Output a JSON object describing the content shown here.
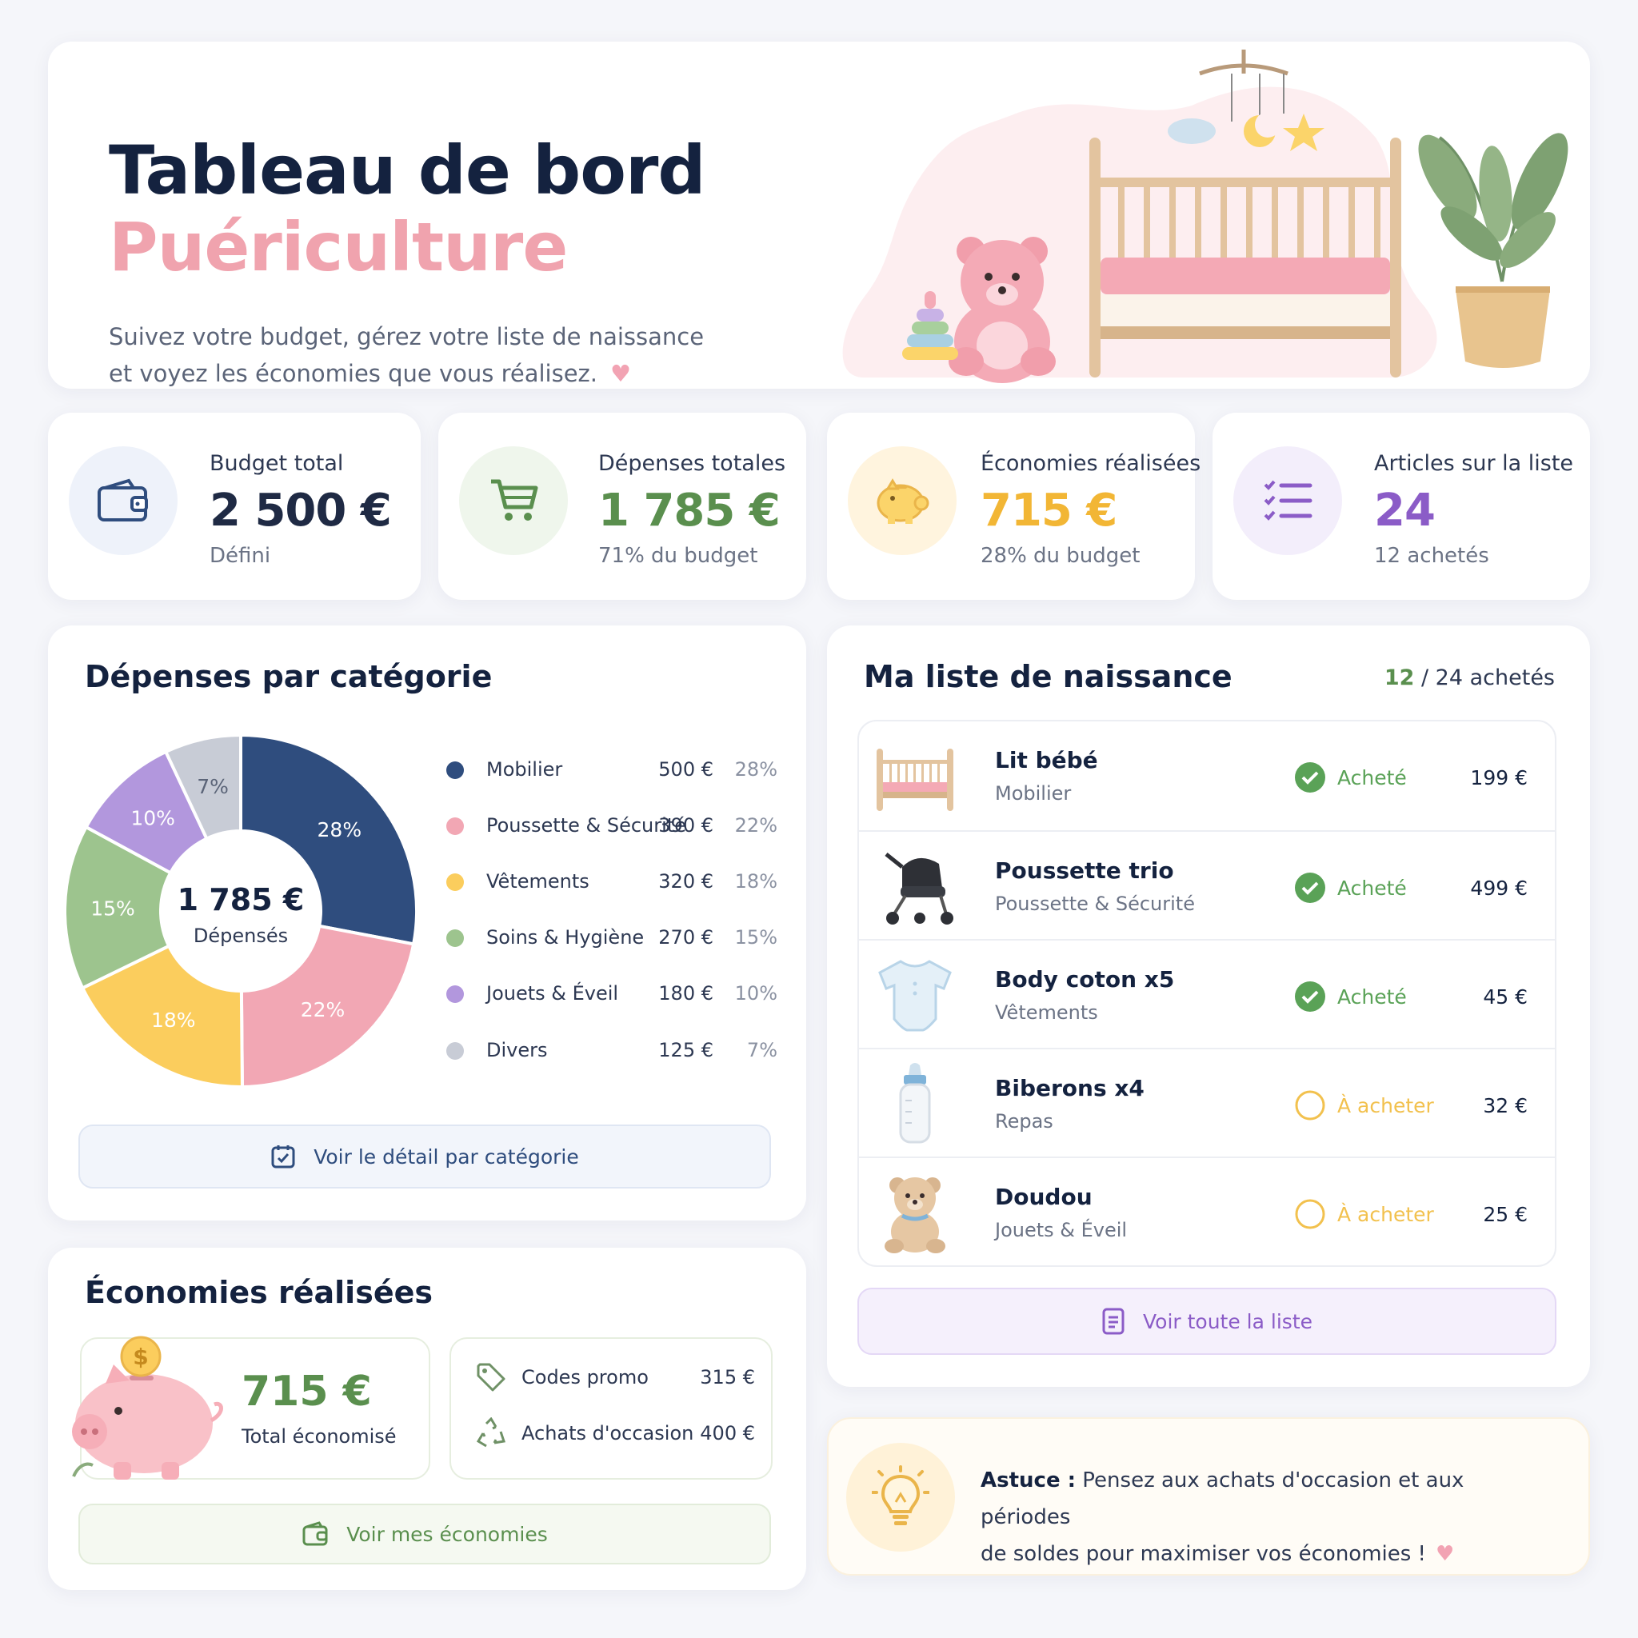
{
  "header": {
    "title_line1": "Tableau de bord",
    "title_line2": "Puériculture",
    "subtitle_line1": "Suivez votre budget, gérez votre liste de naissance",
    "subtitle_line2": "et voyez les économies que vous réalisez."
  },
  "stats": [
    {
      "label": "Budget total",
      "value": "2 500 €",
      "note": "Défini",
      "icon": "wallet-icon",
      "color": "#1f2a44"
    },
    {
      "label": "Dépenses totales",
      "value": "1 785 €",
      "note": "71% du budget",
      "icon": "cart-icon",
      "color": "#5a8f4e"
    },
    {
      "label": "Économies réalisées",
      "value": "715 €",
      "note": "28% du budget",
      "icon": "piggy-bank-icon",
      "color": "#f2b635"
    },
    {
      "label": "Articles sur la liste",
      "value": "24",
      "note": "12 achetés",
      "icon": "checklist-icon",
      "color": "#8b5cc7"
    }
  ],
  "categories": {
    "title": "Dépenses par catégorie",
    "center_value": "1 785 €",
    "center_label": "Dépensés",
    "button_label": "Voir le détail par catégorie",
    "items": [
      {
        "name": "Mobilier",
        "amount": "500 €",
        "pct": "28%",
        "color": "#2f4d7e"
      },
      {
        "name": "Poussette & Sécurité",
        "amount": "390 €",
        "pct": "22%",
        "color": "#f2a7b4"
      },
      {
        "name": "Vêtements",
        "amount": "320 €",
        "pct": "18%",
        "color": "#fbcd5d"
      },
      {
        "name": "Soins & Hygiène",
        "amount": "270 €",
        "pct": "15%",
        "color": "#9dc48e"
      },
      {
        "name": "Jouets & Éveil",
        "amount": "180 €",
        "pct": "10%",
        "color": "#b297dd"
      },
      {
        "name": "Divers",
        "amount": "125 €",
        "pct": "7%",
        "color": "#c8ccd6"
      }
    ]
  },
  "chart_data": {
    "type": "pie",
    "categories": [
      "Mobilier",
      "Poussette & Sécurité",
      "Vêtements",
      "Soins & Hygiène",
      "Jouets & Éveil",
      "Divers"
    ],
    "values": [
      500,
      390,
      320,
      270,
      180,
      125
    ],
    "labels": [
      "28%",
      "22%",
      "18%",
      "15%",
      "10%",
      "7%"
    ],
    "title": "Dépenses par catégorie"
  },
  "savings": {
    "title": "Économies réalisées",
    "total": "715 €",
    "total_label": "Total économisé",
    "rows": [
      {
        "name": "Codes promo",
        "amount": "315 €",
        "icon": "tag-icon"
      },
      {
        "name": "Achats d'occasion",
        "amount": "400 €",
        "icon": "recycle-icon"
      }
    ],
    "button_label": "Voir mes économies"
  },
  "registry": {
    "title": "Ma liste de naissance",
    "count_bought": "12",
    "count_rest": "/ 24 achetés",
    "button_label": "Voir toute la liste",
    "items": [
      {
        "name": "Lit bébé",
        "category": "Mobilier",
        "status": "Acheté",
        "price": "199 €",
        "icon": "crib-icon"
      },
      {
        "name": "Poussette trio",
        "category": "Poussette & Sécurité",
        "status": "Acheté",
        "price": "499 €",
        "icon": "stroller-icon"
      },
      {
        "name": "Body coton x5",
        "category": "Vêtements",
        "status": "Acheté",
        "price": "45 €",
        "icon": "onesie-icon"
      },
      {
        "name": "Biberons x4",
        "category": "Repas",
        "status": "À acheter",
        "price": "32 €",
        "icon": "baby-bottle-icon"
      },
      {
        "name": "Doudou",
        "category": "Jouets & Éveil",
        "status": "À acheter",
        "price": "25 €",
        "icon": "teddy-bear-icon"
      }
    ],
    "colors": {
      "bought": "#5aa257",
      "todo": "#f2c14e"
    }
  },
  "tip": {
    "label": "Astuce :",
    "text_line1": " Pensez aux achats d'occasion et aux périodes",
    "text_line2": "de soldes pour maximiser vos économies !"
  }
}
